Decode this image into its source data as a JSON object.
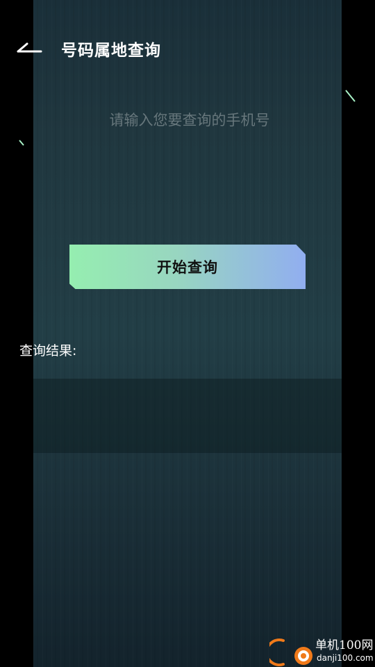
{
  "header": {
    "title": "号码属地查询",
    "back_icon": "back-arrow-icon"
  },
  "search": {
    "placeholder": "请输入您要查询的手机号",
    "value": ""
  },
  "actions": {
    "start_label": "开始查询"
  },
  "result": {
    "label": "查询结果:",
    "value": ""
  },
  "watermark": {
    "name": "单机100网",
    "domain": "danji100.com"
  },
  "colors": {
    "panel_bg": "#20373f",
    "frame_accent": "#a9f3c8",
    "button_gradient_start": "#95eeb0",
    "button_gradient_end": "#91aef0",
    "placeholder": "#66767b",
    "logo_orange": "#f07a1a"
  }
}
